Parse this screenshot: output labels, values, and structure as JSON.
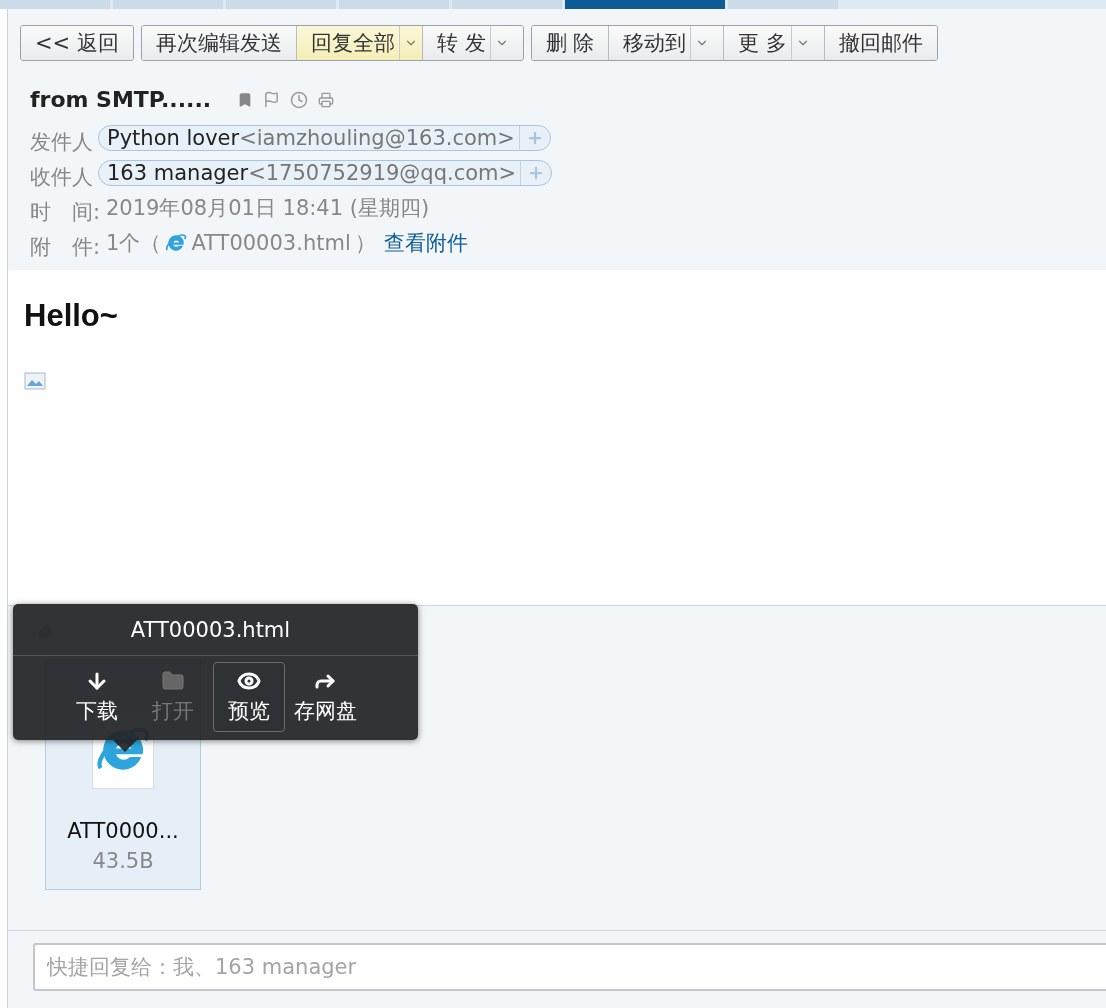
{
  "top_tabs": [
    {
      "selected": false
    },
    {
      "selected": false
    },
    {
      "selected": false
    },
    {
      "selected": false
    },
    {
      "selected": false
    },
    {
      "selected": true
    },
    {
      "selected": false
    }
  ],
  "toolbar": [
    [
      {
        "label": "<< 返回",
        "dropdown": false,
        "highlighted": false
      }
    ],
    [
      {
        "label": "再次编辑发送",
        "dropdown": false,
        "highlighted": false
      },
      {
        "label": "回复全部",
        "dropdown": true,
        "highlighted": true
      },
      {
        "label": "转 发",
        "dropdown": true,
        "highlighted": false
      }
    ],
    [
      {
        "label": "删 除",
        "dropdown": false,
        "highlighted": false
      },
      {
        "label": "移动到",
        "dropdown": true,
        "highlighted": false
      },
      {
        "label": "更 多",
        "dropdown": true,
        "highlighted": false
      },
      {
        "label": "撤回邮件",
        "dropdown": false,
        "highlighted": false
      }
    ]
  ],
  "subject": "from SMTP......",
  "sender": {
    "label": "发件人",
    "name": "Python lover",
    "address": "<iamzhouling@163.com>"
  },
  "recipient": {
    "label": "收件人",
    "name": "163 manager",
    "address": "<1750752919@qq.com>"
  },
  "time": {
    "label": "时　间:",
    "value": "2019年08月01日 18:41 (星期四)"
  },
  "attachment_line": {
    "label": "附　件:",
    "count": "1个（",
    "file": "ATT00003.html",
    "close": "）",
    "link": "查看附件"
  },
  "body": {
    "heading": "Hello~"
  },
  "attachments": {
    "files": [
      {
        "name": "ATT0000...",
        "size": "43.5B"
      }
    ]
  },
  "popup": {
    "title": "ATT00003.html",
    "actions": [
      {
        "kind": "download",
        "label": "下载",
        "disabled": false,
        "selected": false
      },
      {
        "kind": "open",
        "label": "打开",
        "disabled": true,
        "selected": false
      },
      {
        "kind": "preview",
        "label": "预览",
        "disabled": false,
        "selected": true
      },
      {
        "kind": "save",
        "label": "存网盘",
        "disabled": false,
        "selected": false
      }
    ]
  },
  "quick_reply": {
    "placeholder": "快捷回复给：我、163 manager"
  }
}
